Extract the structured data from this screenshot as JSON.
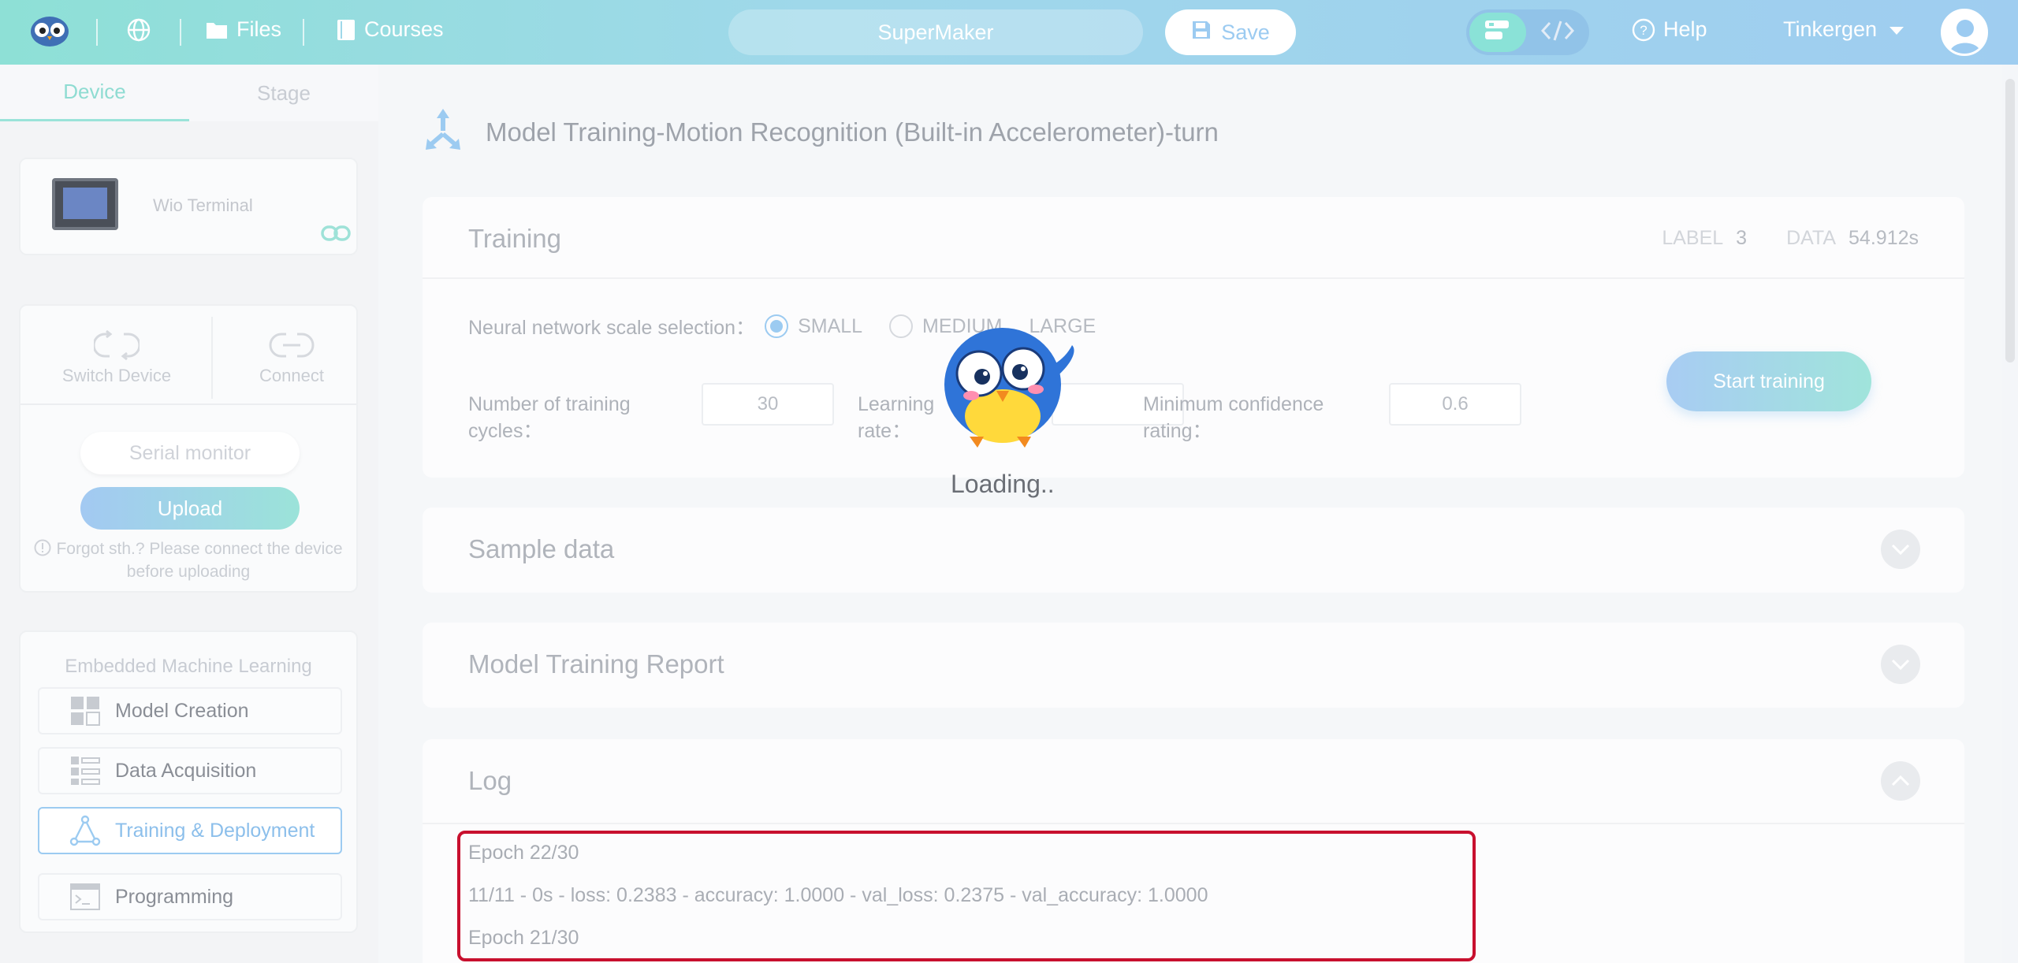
{
  "topbar": {
    "files_label": "Files",
    "courses_label": "Courses",
    "project_name": "SuperMaker",
    "save_label": "Save",
    "help_label": "Help",
    "user_name": "Tinkergen"
  },
  "sidebar": {
    "tabs": [
      {
        "label": "Device"
      },
      {
        "label": "Stage"
      }
    ],
    "device_name": "Wio Terminal",
    "switch_label": "Switch Device",
    "connect_label": "Connect",
    "serial_label": "Serial monitor",
    "upload_label": "Upload",
    "hint": "Forgot sth.? Please connect the device before uploading",
    "ml_title": "Embedded Machine Learning",
    "ml_items": [
      {
        "label": "Model Creation"
      },
      {
        "label": "Data Acquisition"
      },
      {
        "label": "Training & Deployment"
      }
    ],
    "programming_label": "Programming"
  },
  "main": {
    "page_title": "Model Training-Motion Recognition (Built-in Accelerometer)-turn",
    "training": {
      "title": "Training",
      "label_key": "LABEL",
      "label_value": "3",
      "data_key": "DATA",
      "data_value": "54.912s",
      "scale_label": "Neural network scale selection：",
      "scale_options": [
        "SMALL",
        "MEDIUM",
        "LARGE"
      ],
      "cycles_label_1": "Number of training",
      "cycles_label_2": "cycles：",
      "cycles_value": "30",
      "lr_label_1": "Learning",
      "lr_label_2": "rate：",
      "lr_value": "",
      "conf_label_1": "Minimum confidence",
      "conf_label_2": "rating：",
      "conf_value": "0.6",
      "start_label": "Start training"
    },
    "sample_title": "Sample data",
    "report_title": "Model Training Report",
    "log": {
      "title": "Log",
      "lines": [
        "Epoch 22/30",
        "11/11 - 0s - loss: 0.2383 - accuracy: 1.0000 - val_loss: 0.2375 - val_accuracy: 1.0000",
        "Epoch 21/30"
      ]
    }
  },
  "loading_text": "Loading..",
  "colors": {
    "accent": "#9ccbf1",
    "teal": "#8ee0d6",
    "highlight": "#c8102e"
  }
}
